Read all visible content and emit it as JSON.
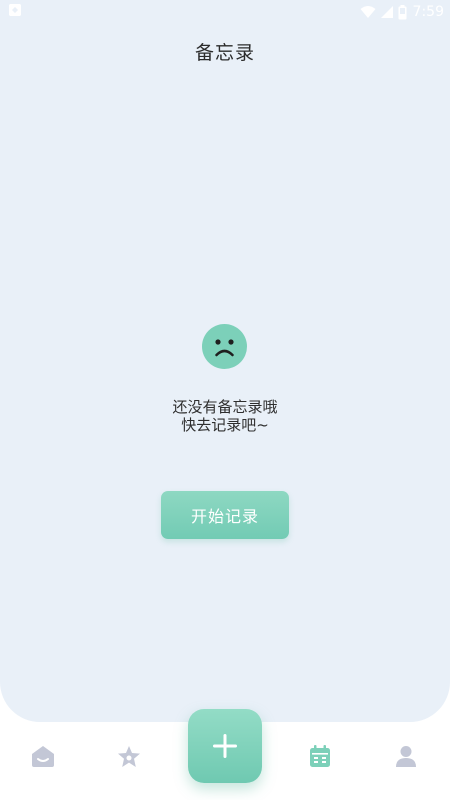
{
  "status_bar": {
    "time": "7:59",
    "icons": [
      "notification-icon",
      "wifi-icon",
      "signal-icon",
      "battery-icon"
    ]
  },
  "header": {
    "title": "备忘录"
  },
  "empty_state": {
    "icon": "sad-face-icon",
    "line1": "还没有备忘录哦",
    "line2": "快去记录吧~",
    "button_label": "开始记录"
  },
  "bottom_nav": {
    "items": [
      {
        "icon": "home-icon",
        "active": false
      },
      {
        "icon": "star-icon",
        "active": false
      },
      {
        "icon": "add-icon",
        "active": false
      },
      {
        "icon": "calendar-icon",
        "active": true
      },
      {
        "icon": "person-icon",
        "active": false
      }
    ]
  },
  "colors": {
    "accent": "#7cd0b9",
    "panel_background": "#e9f0f8",
    "inactive_icon": "#c3c7d6",
    "text": "#2e2e2e"
  }
}
